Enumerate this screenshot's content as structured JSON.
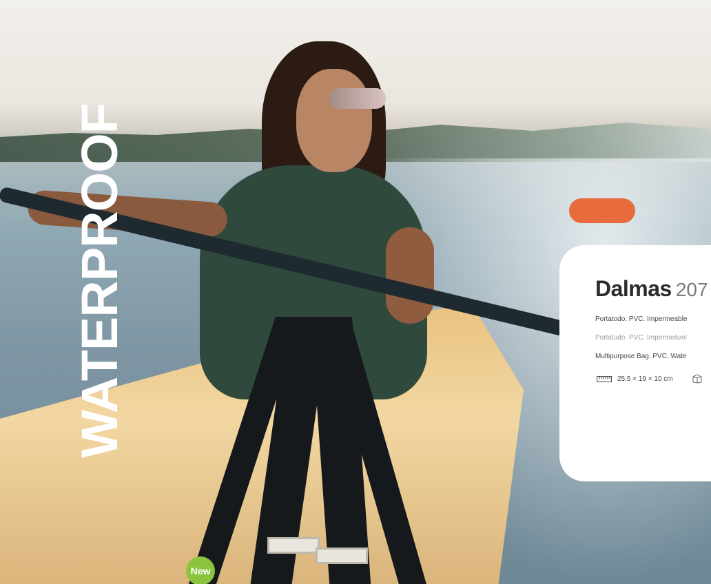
{
  "headline": "WATERPROOF",
  "product": {
    "name": "Dalmas",
    "reference": "207",
    "description_es": "Portatodo. PVC. Impermeable",
    "description_pt": "Portatudo. PVC. Impermeável",
    "description_en": "Multipurpose Bag. PVC. Wate",
    "dimensions": "25.5 × 19 × 10 cm"
  },
  "badge": {
    "label": "New",
    "color": "#8cc43f"
  },
  "icons": [
    "ruler-icon",
    "box-icon"
  ]
}
